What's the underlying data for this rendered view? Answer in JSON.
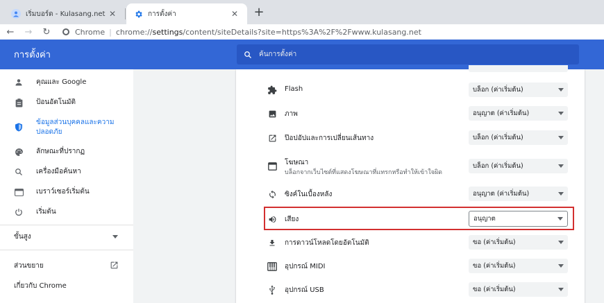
{
  "tabs": [
    {
      "title": "เริ่มบอร์ด - Kulasang.net",
      "active": false
    },
    {
      "title": "การตั้งค่า",
      "active": true
    }
  ],
  "toolbar": {
    "origin_label": "Chrome",
    "url_pre": "chrome://",
    "url_host": "settings",
    "url_post": "/content/siteDetails?site=https%3A%2F%2Fwww.kulasang.net"
  },
  "header": {
    "title": "การตั้งค่า",
    "search_placeholder": "ค้นการตั้งค่า"
  },
  "sidebar": {
    "items": [
      {
        "label": "คุณและ Google",
        "icon": "person-icon"
      },
      {
        "label": "ป้อนอัตโนมัติ",
        "icon": "clipboard-icon"
      },
      {
        "label": "ข้อมูลส่วนบุคคลและความปลอดภัย",
        "icon": "shield-icon",
        "selected": true
      },
      {
        "label": "ลักษณะที่ปรากฏ",
        "icon": "palette-icon"
      },
      {
        "label": "เครื่องมือค้นหา",
        "icon": "search-icon"
      },
      {
        "label": "เบราว์เซอร์เริ่มต้น",
        "icon": "browser-icon"
      },
      {
        "label": "เริ่มต้น",
        "icon": "power-icon"
      }
    ],
    "advanced": "ขั้นสูง",
    "extensions": "ส่วนขยาย",
    "about": "เกี่ยวกับ Chrome"
  },
  "permissions": [
    {
      "label": "Flash",
      "sub": "",
      "value": "บล็อก (ค่าเริ่มต้น)",
      "icon": "puzzle-icon"
    },
    {
      "label": "ภาพ",
      "sub": "",
      "value": "อนุญาต (ค่าเริ่มต้น)",
      "icon": "image-icon"
    },
    {
      "label": "ป๊อปอัปและการเปลี่ยนเส้นทาง",
      "sub": "",
      "value": "บล็อก (ค่าเริ่มต้น)",
      "icon": "open-in-new-icon"
    },
    {
      "label": "โฆษณา",
      "sub": "บล็อกจากเว็บไซต์ที่แสดงโฆษณาที่แทรกหรือทำให้เข้าใจผิด",
      "value": "บล็อก (ค่าเริ่มต้น)",
      "icon": "ads-icon"
    },
    {
      "label": "ซิงค์ในเบื้องหลัง",
      "sub": "",
      "value": "อนุญาต (ค่าเริ่มต้น)",
      "icon": "sync-icon"
    },
    {
      "label": "เสียง",
      "sub": "",
      "value": "อนุญาต",
      "icon": "speaker-icon",
      "highlighted": true
    },
    {
      "label": "การดาวน์โหลดโดยอัตโนมัติ",
      "sub": "",
      "value": "ขอ (ค่าเริ่มต้น)",
      "icon": "download-icon"
    },
    {
      "label": "อุปกรณ์ MIDI",
      "sub": "",
      "value": "ขอ (ค่าเริ่มต้น)",
      "icon": "piano-icon"
    },
    {
      "label": "อุปกรณ์ USB",
      "sub": "",
      "value": "ขอ (ค่าเริ่มต้น)",
      "icon": "usb-icon"
    }
  ],
  "colors": {
    "header": "#3367d6",
    "accent": "#1a73e8",
    "highlight_border": "#d32f2f"
  }
}
